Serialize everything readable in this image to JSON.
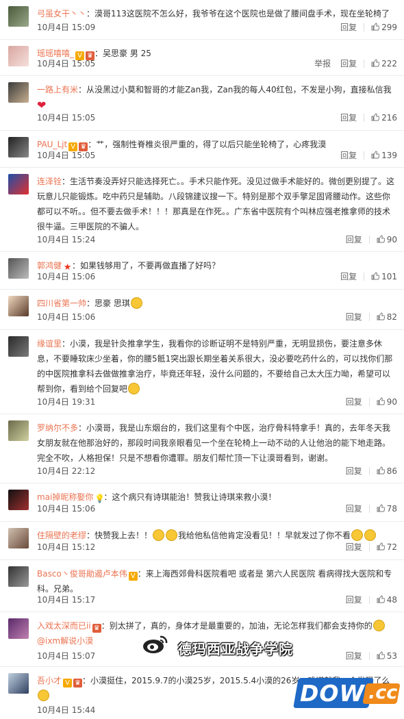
{
  "actions": {
    "report": "举报",
    "reply": "回复"
  },
  "comments": [
    {
      "user": "弓虽女干丶丶",
      "sep": "：",
      "text": "漠哥113这医院不怎么好，我爷爷在这个医院也是做了腰间盘手术，现在坐轮椅了",
      "time": "10月4日 15:09",
      "likes": "299"
    },
    {
      "user": "瑶瑶嘻嘻_",
      "sep": "：",
      "text": "吴思豪 男 25",
      "time": "10月4日 15:05",
      "likes": "222"
    },
    {
      "user": "一路上有米",
      "sep": "：",
      "text": "从没黑过小莫和智哥的才能Zan我，Zan我的每人40红包，不发是小狗，直接私信我",
      "time": "10月4日 15:05",
      "likes": "216"
    },
    {
      "user": "PAU_Ljt",
      "sep": "：",
      "text": "艹，强制性脊椎炎很严重的，得了以后只能坐轮椅了，心疼我漠",
      "time": "10月4日 15:05",
      "likes": "139"
    },
    {
      "user": "连泽铨",
      "sep": "：",
      "text": "生活节奏没弄好只能选择死亡。。手术只能作死。没见过做手术能好的。微创更别提了。这玩意儿只能锻炼。吃中药只是辅助。八段锦建议搜一下。特别是那个双手擎足固肾腰动作。这些你都可以不听。。但不要去做手术！！！那真是在作死。。广东省中医院有个叫林应强老推拿师的技术很牛逼。三甲医院的不骗人。",
      "time": "10月4日 15:24",
      "likes": "90"
    },
    {
      "user": "郭鸿健",
      "sep": "：",
      "text": "如果钱够用了，不要再做直播了好吗？",
      "time": "10月4日 15:06",
      "likes": "101"
    },
    {
      "user": "四川省第一帅",
      "sep": "：",
      "text": "思豪 思琪",
      "time": "10月4日 15:06",
      "likes": "82"
    },
    {
      "user": "缘谊里",
      "sep": "：",
      "text": "小漠，我是针灸推拿学生，我看你的诊断证明不是特别严重，无明显损伤，要注意多休息，不要睡软床少坐着，你的腰5骶1突出跟长期坐着关系很大，没必要吃药什么的，可以找你们那的中医院推拿科去做做推拿治疗，毕竟还年轻，没什么问题的，不要给自己太大压力呦，希望可以帮到你，看到给个回复吧",
      "time": "10月4日 19:31",
      "likes": "90"
    },
    {
      "user": "罗纳尔不多",
      "sep": "：",
      "text": "小漠哥，我是山东烟台的，我们这里有个中医，治疗骨科特拿手！真的，去年冬天我女朋友就在他那治好的，那段时间我亲眼看见一个坐在轮椅上一动不动的人让他治的能下地走路。完全不吹，人格担保！只是不想看你遭罪。朋友们帮忙顶一下让漠哥看到，谢谢。",
      "time": "10月4日 22:12",
      "likes": "86"
    },
    {
      "user": "mai掉昵称娶你",
      "sep": "：",
      "text": "这个病只有诗琪能治！赞我让诗琪来救小漠！",
      "time": "10月4日 15:06",
      "likes": "78"
    },
    {
      "user": "住隔壁的老缪",
      "sep": "：",
      "text_a": "快赞我上去！！",
      "text_b": "我给他私信他肯定没看见！！早就发过了你不看",
      "time": "10月4日 15:12",
      "likes": "72"
    },
    {
      "user": "Basco丶俊哥勛遏卢本伟",
      "sep": "：",
      "text": "来上海西郊骨科医院看吧 或者是 第六人民医院 看病得找大医院和专科。兄弟。",
      "time": "10月4日 15:17",
      "likes": "48"
    },
    {
      "user": "入戏太深而已ii",
      "sep": "：",
      "text": "别太拼了，真的，身体才是最重要的，加油，无论怎样我们都会支持你的",
      "mention": "@ixm解说小漠",
      "time": "10月4日 15:07",
      "likes": "53"
    },
    {
      "user": "吾小才",
      "sep": "：",
      "text": "小漠挺住，2015.9.7的小漠25岁，2015.5.4小漠的26岁，难道就我一个发现了么",
      "time": "10月4日 15:44",
      "likes": ""
    }
  ],
  "watermark": {
    "text": "德玛西亚战争学院",
    "logo": "weibo-logo"
  },
  "site_logo": {
    "main": "DOWN",
    "suffix": ".cc"
  },
  "colors": {
    "username": "#eb7350",
    "text": "#333333",
    "vip": "#f6a900"
  }
}
